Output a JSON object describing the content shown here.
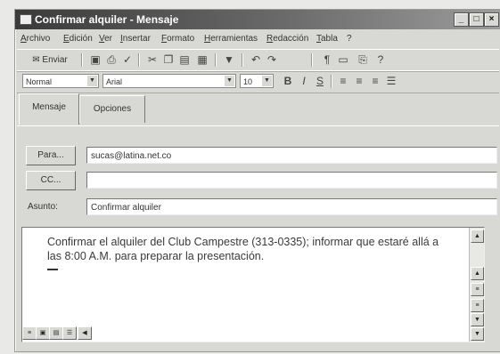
{
  "window": {
    "title": "Confirmar alquiler - Mensaje",
    "controls": {
      "minimize": "_",
      "maximize": "□",
      "close": "×"
    }
  },
  "menubar": [
    "Archivo",
    "Edición",
    "Ver",
    "Insertar",
    "Formato",
    "Herramientas",
    "Redacción",
    "Tabla",
    "?"
  ],
  "toolbar": {
    "send_label": "Enviar"
  },
  "format_toolbar": {
    "style": "Normal",
    "font": "Arial",
    "size": "10"
  },
  "tabs": [
    "Mensaje",
    "Opciones"
  ],
  "fields": {
    "to_button": "Para...",
    "to_value": "sucas@latina.net.co",
    "cc_button": "CC...",
    "cc_value": "",
    "subject_label": "Asunto:",
    "subject_value": "Confirmar alquiler"
  },
  "body": {
    "text": "Confirmar el alquiler del Club Campestre (313-0335); informar que estaré allá a las 8:00 A.M. para preparar la presentación."
  }
}
